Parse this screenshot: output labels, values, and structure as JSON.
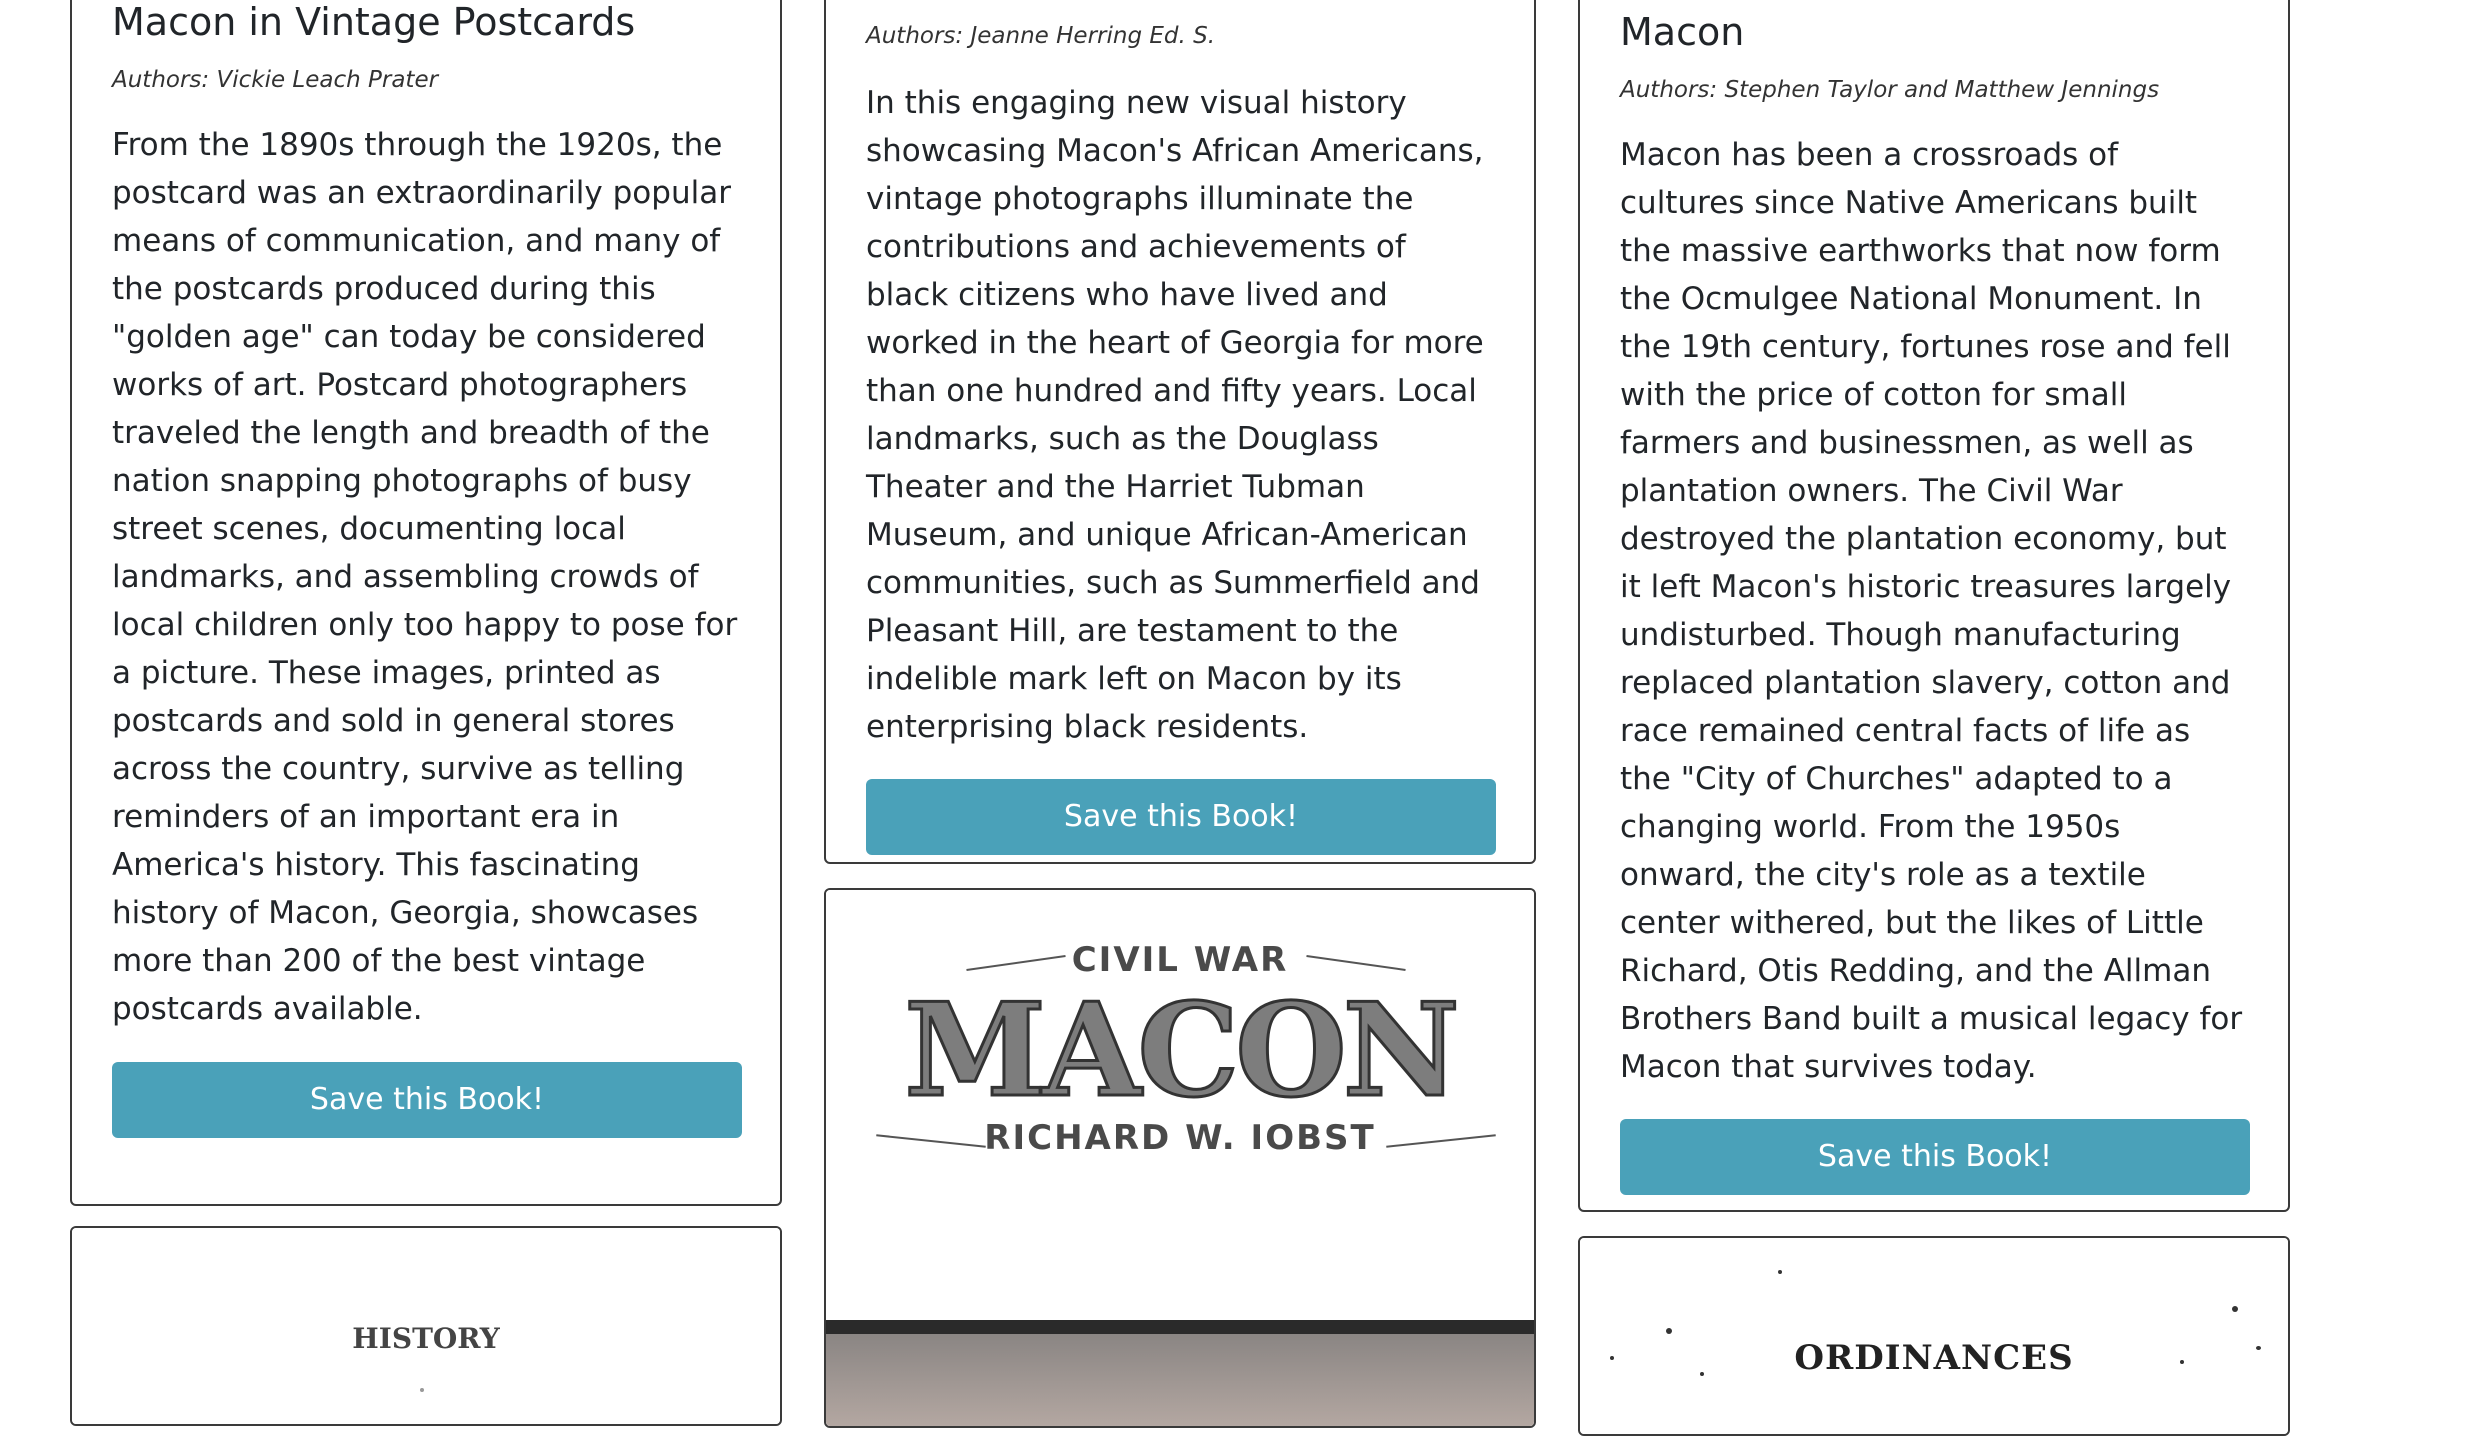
{
  "cards": {
    "c1": {
      "title": "Macon in Vintage Postcards",
      "authors": "Authors: Vickie Leach Prater",
      "description": "From the 1890s through the 1920s, the postcard was an extraordinarily popular means of communication, and many of the postcards produced during this \"golden age\" can today be considered works of art. Postcard photographers traveled the length and breadth of the nation snapping photographs of busy street scenes, documenting local landmarks, and assembling crowds of local children only too happy to pose for a picture. These images, printed as postcards and sold in general stores across the country, survive as telling reminders of an important era in America's history. This fascinating history of Macon, Georgia, showcases more than 200 of the best vintage postcards available.",
      "button": "Save this Book!"
    },
    "c2": {
      "authors": "Authors: Jeanne Herring Ed. S.",
      "description": "In this engaging new visual history showcasing Macon's African Americans, vintage photographs illuminate the contributions and achievements of black citizens who have lived and worked in the heart of Georgia for more than one hundred and fifty years. Local landmarks, such as the Douglass Theater and the Harriet Tubman Museum, and unique African-American communities, such as Summerfield and Pleasant Hill, are testament to the indelible mark left on Macon by its enterprising black residents.",
      "button": "Save this Book!"
    },
    "c3": {
      "title": "Macon",
      "authors": "Authors: Stephen Taylor and Matthew Jennings",
      "description": "Macon has been a crossroads of cultures since Native Americans built the massive earthworks that now form the Ocmulgee National Monument. In the 19th century, fortunes rose and fell with the price of cotton for small farmers and businessmen, as well as plantation owners. The Civil War destroyed the plantation economy, but it left Macon's historic treasures largely undisturbed. Though manufacturing replaced plantation slavery, cotton and race remained central facts of life as the \"City of Churches\" adapted to a changing world. From the 1950s onward, the city's role as a textile center withered, but the likes of Little Richard, Otis Redding, and the Allman Brothers Band built a musical legacy for Macon that survives today.",
      "button": "Save this Book!"
    }
  },
  "covers": {
    "history": {
      "text": "HISTORY"
    },
    "civil_war_macon": {
      "top": "CIVIL WAR",
      "main": "MACON",
      "author": "RICHARD W. IOBST"
    },
    "ordinances": {
      "text": "ORDINANCES"
    }
  }
}
